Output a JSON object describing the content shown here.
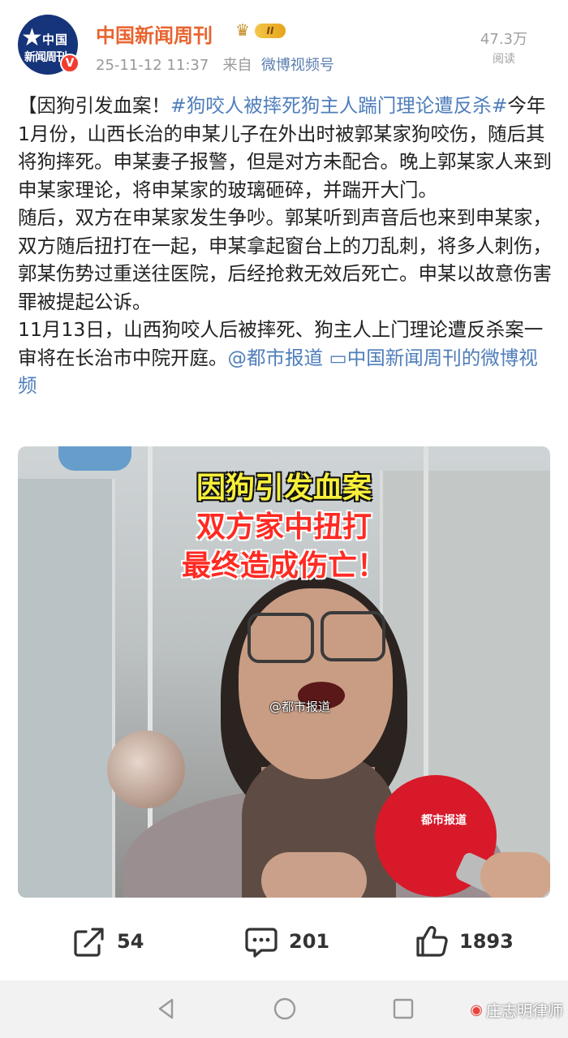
{
  "account": {
    "name": "中国新闻周刊",
    "avatar_text_line1": "中国",
    "avatar_text_line2": "新闻周刊",
    "verified_badge": "V",
    "level_badge": "II",
    "timestamp": "25-11-12 11:37",
    "source_prefix": "来自",
    "source_name": "微博视频号"
  },
  "views": {
    "count": "47.3万",
    "label": "阅读"
  },
  "post": {
    "p1_title": "【因狗引发血案！",
    "p1_hashtag": "#狗咬人被摔死狗主人踹门理论遭反杀#",
    "p1_body": "今年1月份，山西长治的申某儿子在外出时被郭某家狗咬伤，随后其将狗摔死。申某妻子报警，但是对方未配合。晚上郭某家人来到申某家理论，将申某家的玻璃砸碎，并踹开大门。",
    "p2_body": "随后，双方在申某家发生争吵。郭某听到声音后也来到申某家，双方随后扭打在一起，申某拿起窗台上的刀乱刺，将多人刺伤，郭某伤势过重送往医院，后经抢救无效后死亡。申某以故意伤害罪被提起公诉。",
    "p3_body": "11月13日，山西狗咬人后被摔死、狗主人上门理论遭反杀案一审将在长治市中院开庭。",
    "p3_mention": "@都市报道",
    "p3_video_link": "中国新闻周刊的微博视频"
  },
  "video": {
    "caption_line1": "因狗引发血案",
    "caption_line2": "双方家中扭打",
    "caption_line3": "最终造成伤亡！",
    "watermark": "@都市报道",
    "mic_label": "都市报道"
  },
  "actions": {
    "share_count": "54",
    "comment_count": "201",
    "like_count": "1893"
  },
  "navbar": {
    "author_watermark": "庄志明律师"
  },
  "icons": {
    "share": "share-icon",
    "comment": "comment-icon",
    "like": "thumbs-up-icon",
    "back": "back-triangle-icon",
    "home": "home-circle-icon",
    "recent": "recent-square-icon"
  },
  "colors": {
    "account_name": "#e8632f",
    "link": "#4f7ebb",
    "caption_yellow": "#f7ef3a",
    "caption_red": "#ff2a22"
  }
}
